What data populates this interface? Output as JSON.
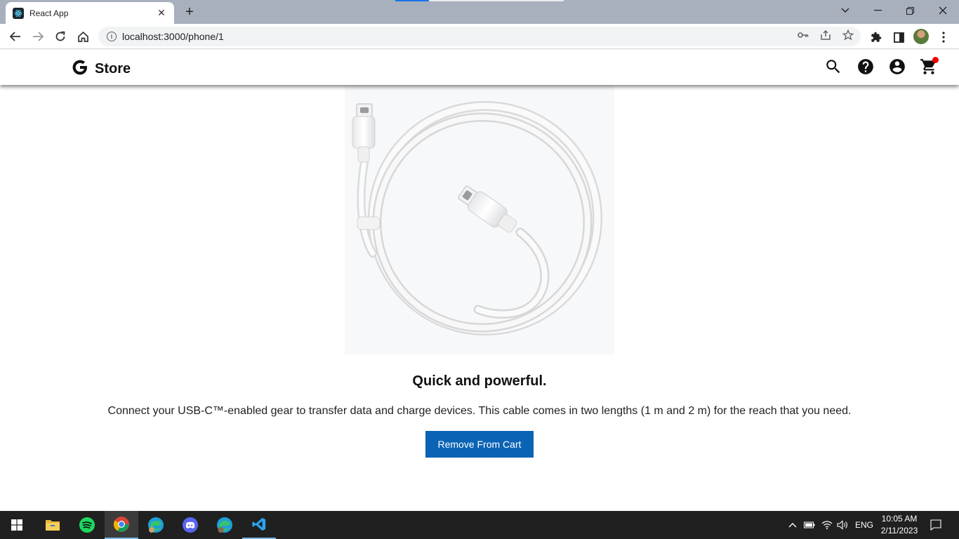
{
  "browser": {
    "tab_title": "React App",
    "tab_close": "✕",
    "new_tab": "+",
    "url": "localhost:3000/phone/1"
  },
  "header": {
    "store_label": "Store"
  },
  "product": {
    "headline": "Quick and powerful.",
    "description": "Connect your USB-C™-enabled gear to transfer data and charge devices. This cable comes in two lengths (1 m and 2 m) for the reach that you need.",
    "button_label": "Remove From Cart"
  },
  "taskbar": {
    "language": "ENG",
    "time": "10:05 AM",
    "date": "2/11/2023"
  },
  "colors": {
    "button_bg": "#0b63b5",
    "cart_badge": "#ee0000",
    "taskbar_bg": "#202020"
  }
}
